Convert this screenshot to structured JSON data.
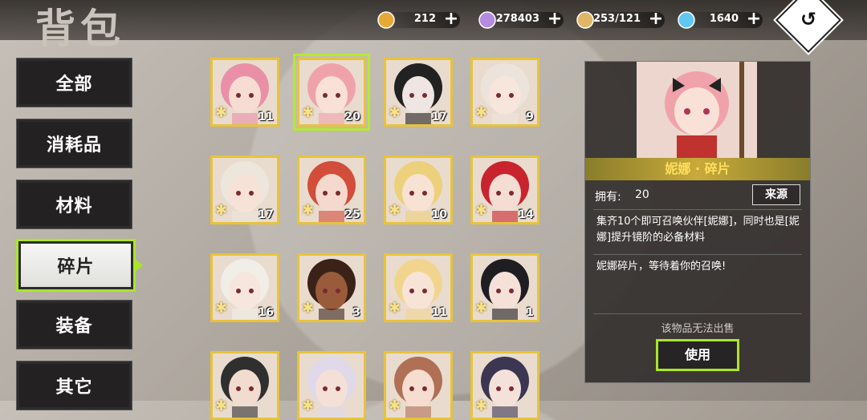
{
  "header": {
    "title": "背包"
  },
  "resources": [
    {
      "icon": "gold-coin-icon",
      "value": "212",
      "color": "#e6a935"
    },
    {
      "icon": "purple-crystal-icon",
      "value": "278403",
      "color": "#b48be0"
    },
    {
      "icon": "supply-crate-icon",
      "value": "253/121",
      "color": "#e0b565"
    },
    {
      "icon": "blue-diamond-icon",
      "value": "1640",
      "color": "#5fc7f2"
    }
  ],
  "tabs": [
    {
      "label": "全部",
      "active": false
    },
    {
      "label": "消耗品",
      "active": false
    },
    {
      "label": "材料",
      "active": false
    },
    {
      "label": "碎片",
      "active": true
    },
    {
      "label": "装备",
      "active": false
    },
    {
      "label": "其它",
      "active": false
    }
  ],
  "items": [
    {
      "count": "11",
      "hair": "#e990a6",
      "skin": "#f7dcd3"
    },
    {
      "count": "20",
      "hair": "#f0a2aa",
      "skin": "#f9e1d7",
      "selected": true
    },
    {
      "count": "17",
      "hair": "#222222",
      "skin": "#efe6e3"
    },
    {
      "count": "9",
      "hair": "#ece4dc",
      "skin": "#f8e5dc"
    },
    {
      "count": "17",
      "hair": "#ece6dc",
      "skin": "#f7e2d8"
    },
    {
      "count": "25",
      "hair": "#d24d3a",
      "skin": "#f6d9ce"
    },
    {
      "count": "10",
      "hair": "#ecd07c",
      "skin": "#f8e2d3"
    },
    {
      "count": "14",
      "hair": "#c9242e",
      "skin": "#f5ddd4"
    },
    {
      "count": "16",
      "hair": "#f1eee8",
      "skin": "#f7e6dd"
    },
    {
      "count": "3",
      "hair": "#3a2219",
      "skin": "#9a5b3a"
    },
    {
      "count": "11",
      "hair": "#f1d58f",
      "skin": "#f8e4d7"
    },
    {
      "count": "1",
      "hair": "#1e1e22",
      "skin": "#f5e1d8"
    },
    {
      "count": "",
      "hair": "#2f2f2f",
      "skin": "#f1dccf"
    },
    {
      "count": "",
      "hair": "#dfd9ea",
      "skin": "#f5e0d8"
    },
    {
      "count": "",
      "hair": "#b07055",
      "skin": "#f6ddd0"
    },
    {
      "count": "",
      "hair": "#3b3652",
      "skin": "#f4e2da"
    }
  ],
  "detail": {
    "name": "妮娜 · 碎片",
    "owned_label": "拥有:",
    "owned_value": "20",
    "source_button": "来源",
    "description_1": "集齐10个即可召唤伙伴[妮娜]，同时也是[妮娜]提升镜阶的必备材料",
    "description_2": "妮娜碎片，等待着你的召唤!",
    "sell_note": "该物品无法出售",
    "use_button": "使用"
  },
  "colors": {
    "accent": "#a9e62a",
    "card_gold": "#e8c33a",
    "name_text": "#ffdf5e"
  }
}
